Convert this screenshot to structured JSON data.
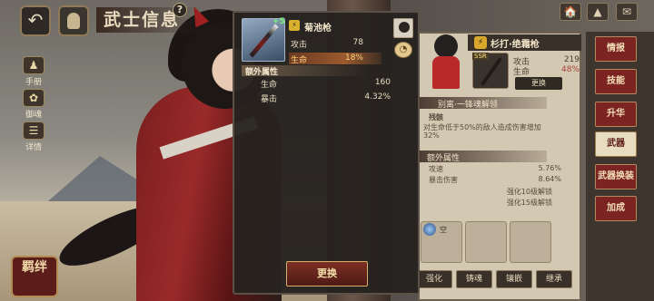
{
  "header": {
    "back_icon": "↶",
    "title": "武士信息",
    "help": "?"
  },
  "top_right_icons": [
    "🏠",
    "▲",
    "✉"
  ],
  "side_buttons": [
    {
      "glyph": "♟",
      "label": "手册"
    },
    {
      "glyph": "✿",
      "label": "御魂"
    },
    {
      "glyph": "☰",
      "label": "详情"
    }
  ],
  "bond_button": {
    "label": "羁绊"
  },
  "popup": {
    "plus": "+5",
    "weapon_type_icon": "⚡",
    "weapon_name": "菊池枪",
    "stats": [
      {
        "label": "攻击",
        "value": "78"
      },
      {
        "label": "生命",
        "value": "18%"
      }
    ],
    "extra_section": "额外属性",
    "extra_stats": [
      {
        "label": "生命",
        "value": "160"
      },
      {
        "label": "暴击",
        "value": "4.32%"
      }
    ],
    "change_button": "更换"
  },
  "right_card": {
    "weapon_name": "杉打·绝霜枪",
    "weapon_type_icon": "⚡",
    "rank": "SSR",
    "stats": [
      {
        "label": "攻击",
        "value": "219"
      },
      {
        "label": "生命",
        "value": "48%"
      }
    ],
    "change_button": "更换",
    "skill_section": "别离·一锋魂解领",
    "skill_name": "残骸",
    "skill_desc_1": "对生命低于50%的敌人造成伤害增加",
    "skill_desc_2": "32%",
    "extra_section": "额外属性",
    "extra_stats": [
      {
        "label": "攻速",
        "value": "5.76%"
      },
      {
        "label": "暴击伤害",
        "value": "8.64%"
      }
    ],
    "unlocks": [
      "强化10级解锁",
      "强化15级解锁"
    ],
    "gem_text": "空",
    "bottom_tabs": [
      "强化",
      "铸魂",
      "镶嵌",
      "继承"
    ]
  },
  "right_tabs": [
    {
      "label": "情报",
      "active": false
    },
    {
      "label": "技能",
      "active": false
    },
    {
      "label": "升华",
      "active": false
    },
    {
      "label": "武器",
      "active": true
    },
    {
      "label": "武器换装",
      "active": false
    },
    {
      "label": "加成",
      "active": false
    }
  ]
}
